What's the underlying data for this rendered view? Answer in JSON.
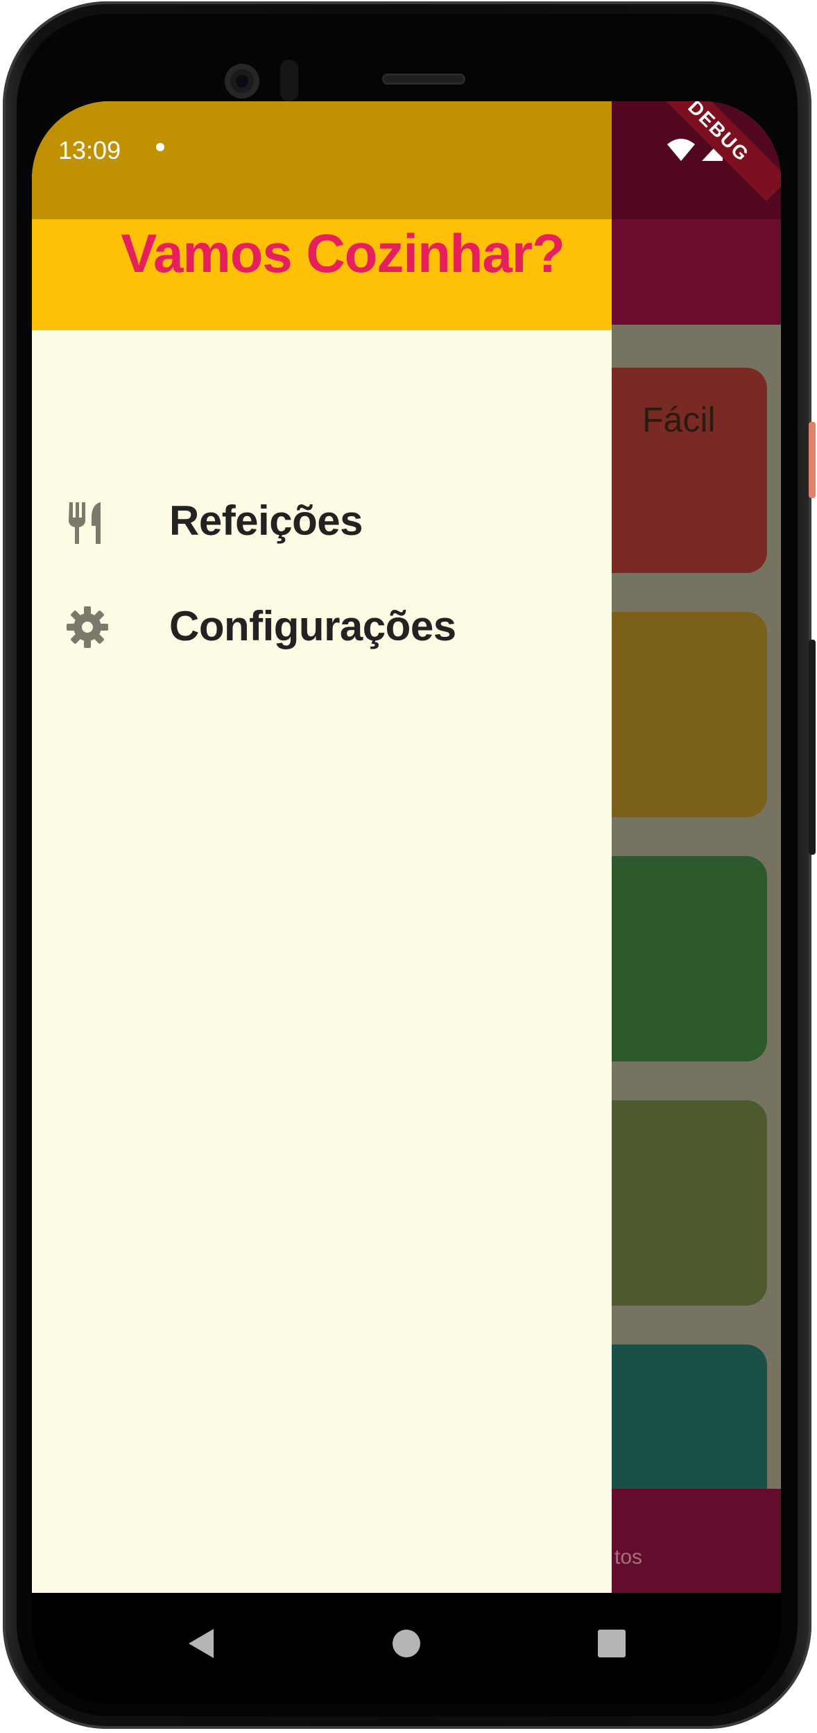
{
  "status_bar": {
    "time": "13:09"
  },
  "debug_banner": "DEBUG",
  "drawer": {
    "title": "Vamos Cozinhar?",
    "items": [
      {
        "label": "Refeições",
        "icon": "restaurant-icon"
      },
      {
        "label": "Configurações",
        "icon": "settings-icon"
      }
    ]
  },
  "background_app": {
    "first_card_partial_label": "Fácil",
    "bottom_nav_partial_label": "tos",
    "card_colors": [
      "#7a2a24",
      "#7a6018",
      "#2d5a2d",
      "#4c5a2e",
      "#1a5048"
    ]
  },
  "colors": {
    "drawer_status_bar": "#c09203",
    "drawer_header": "#ffc107",
    "drawer_title": "#e6205c",
    "drawer_body": "#fdfbe3",
    "app_primary": "#6b0d2e"
  },
  "navigation_bar": {
    "buttons": [
      "back-icon",
      "home-icon",
      "recents-icon"
    ]
  }
}
